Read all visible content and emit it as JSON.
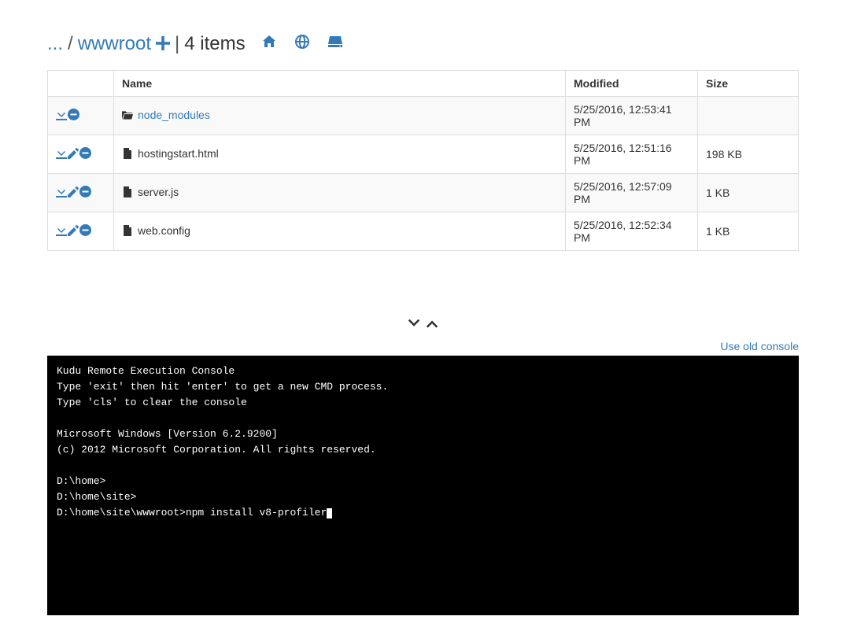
{
  "breadcrumb": {
    "ellipsis": "...",
    "sep1": " / ",
    "current": "wwwroot",
    "plus_title": "Add",
    "divider": " | ",
    "item_count_text": "4 items"
  },
  "header_icons": {
    "home": "home-icon",
    "globe": "globe-icon",
    "disk": "disk-icon"
  },
  "table": {
    "columns": {
      "actions": "",
      "name": "Name",
      "modified": "Modified",
      "size": "Size"
    },
    "rows": [
      {
        "type": "folder",
        "name": "node_modules",
        "is_link": true,
        "modified": "5/25/2016, 12:53:41 PM",
        "size": "",
        "actions": [
          "download",
          "delete"
        ]
      },
      {
        "type": "file",
        "name": "hostingstart.html",
        "is_link": false,
        "modified": "5/25/2016, 12:51:16 PM",
        "size": "198 KB",
        "actions": [
          "download",
          "edit",
          "delete"
        ]
      },
      {
        "type": "file",
        "name": "server.js",
        "is_link": false,
        "modified": "5/25/2016, 12:57:09 PM",
        "size": "1 KB",
        "actions": [
          "download",
          "edit",
          "delete"
        ]
      },
      {
        "type": "file",
        "name": "web.config",
        "is_link": false,
        "modified": "5/25/2016, 12:52:34 PM",
        "size": "1 KB",
        "actions": [
          "download",
          "edit",
          "delete"
        ]
      }
    ]
  },
  "toggle": {
    "down": "▾",
    "up": "▴"
  },
  "old_console_link": "Use old console",
  "console": {
    "lines": [
      "Kudu Remote Execution Console",
      "Type 'exit' then hit 'enter' to get a new CMD process.",
      "Type 'cls' to clear the console",
      "",
      "Microsoft Windows [Version 6.2.9200]",
      "(c) 2012 Microsoft Corporation. All rights reserved.",
      "",
      "D:\\home>",
      "D:\\home\\site>"
    ],
    "prompt": "D:\\home\\site\\wwwroot>",
    "input": "npm install v8-profiler"
  }
}
